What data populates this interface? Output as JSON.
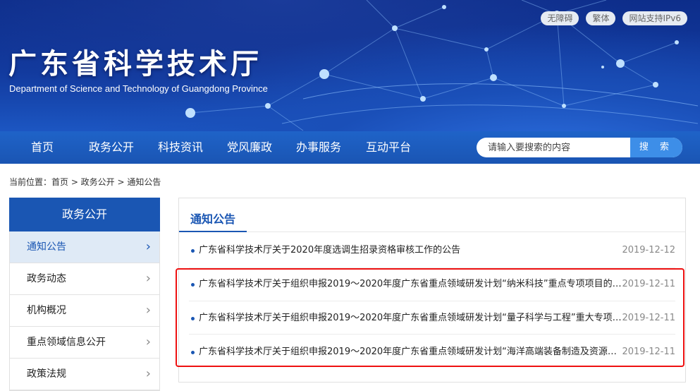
{
  "header": {
    "title": "广东省科学技术厅",
    "subtitle": "Department of Science and Technology of Guangdong Province",
    "top_links": [
      "无障碍",
      "繁体",
      "网站支持IPv6"
    ]
  },
  "nav": {
    "items": [
      "首页",
      "政务公开",
      "科技资讯",
      "党风廉政",
      "办事服务",
      "互动平台"
    ],
    "search_placeholder": "请输入要搜索的内容",
    "search_button": "搜 索"
  },
  "breadcrumb": "当前位置：首页 > 政务公开 > 通知公告",
  "sidebar": {
    "heading": "政务公开",
    "items": [
      {
        "label": "通知公告",
        "active": true
      },
      {
        "label": "政务动态"
      },
      {
        "label": "机构概况"
      },
      {
        "label": "重点领域信息公开"
      },
      {
        "label": "政策法规"
      }
    ]
  },
  "main": {
    "title": "通知公告",
    "notices": [
      {
        "title": "广东省科学技术厅关于2020年度选调生招录资格审核工作的公告",
        "date": "2019-12-12"
      },
      {
        "title": "广东省科学技术厅关于组织申报2019～2020年度广东省重点领域研发计划“纳米科技”重点专项项目的…",
        "date": "2019-12-11"
      },
      {
        "title": "广东省科学技术厅关于组织申报2019～2020年度广东省重点领域研发计划“量子科学与工程”重大专项…",
        "date": "2019-12-11"
      },
      {
        "title": "广东省科学技术厅关于组织申报2019～2020年度广东省重点领域研发计划“海洋高端装备制造及资源保…",
        "date": "2019-12-11"
      }
    ]
  },
  "colors": {
    "primary": "#1a56b3",
    "highlight": "#ee1111"
  },
  "icons": {
    "chevron": "chevron-right-icon",
    "bullet": "bullet-icon"
  }
}
